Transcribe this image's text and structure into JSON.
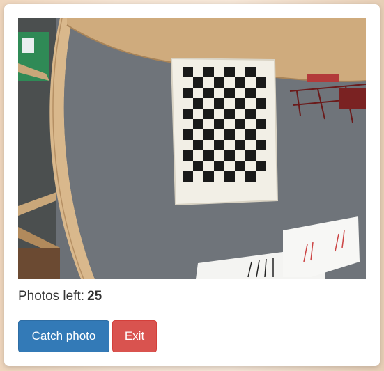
{
  "camera": {
    "description_icon": "camera-feed-image"
  },
  "status": {
    "label": "Photos left:",
    "count": "25"
  },
  "actions": {
    "catch_label": "Catch photo",
    "exit_label": "Exit"
  },
  "colors": {
    "primary": "#337ab7",
    "danger": "#d9534f",
    "text": "#333333",
    "card": "#ffffff"
  }
}
